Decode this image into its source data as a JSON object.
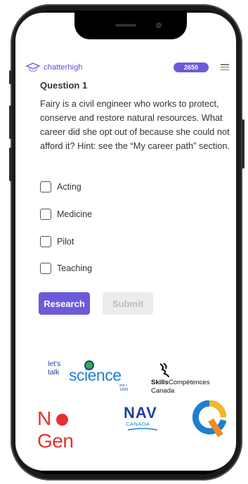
{
  "header": {
    "brand": "chatterhigh",
    "points": "2650"
  },
  "question": {
    "title": "Question 1",
    "text": "Fairy is a civil engineer who works to protect, conserve and restore natural resources. What career did she opt out of because she could not afford it? Hint: see the “My career path” section.",
    "options": [
      "Acting",
      "Medicine",
      "Pilot",
      "Teaching"
    ]
  },
  "actions": {
    "research": "Research",
    "submit": "Submit"
  },
  "sponsors": {
    "lts_small": "let's talk",
    "lts_big": "science",
    "lts_est": "est • 1993",
    "skills_bold": "Skills",
    "skills_rest": "Compétences",
    "skills_line2": "Canada",
    "ngen_a": "N",
    "ngen_b": "Gen",
    "nav_main": "NAV",
    "nav_sub": "CANADA"
  },
  "colors": {
    "accent": "#6b5bd9",
    "brand": "#5a4fd6",
    "submit_bg": "#ececec"
  }
}
